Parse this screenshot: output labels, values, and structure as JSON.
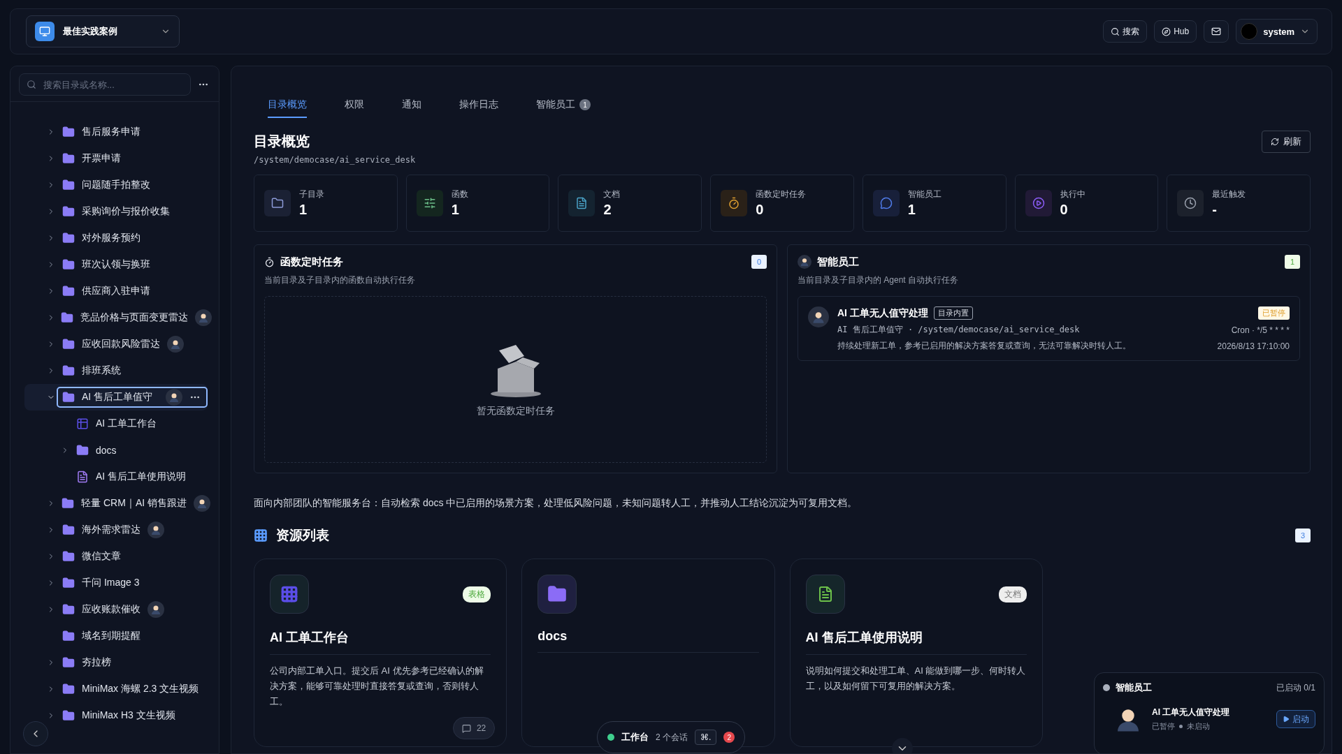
{
  "workspace": {
    "name": "最佳实践案例"
  },
  "topbar": {
    "search": "搜索",
    "hub": "Hub",
    "user": "system"
  },
  "sidebar": {
    "search_placeholder": "搜索目录或名称...",
    "tree": [
      {
        "label": "售后服务申请",
        "kind": "folder",
        "expandable": true,
        "expanded": false,
        "selected": false,
        "agent": false
      },
      {
        "label": "开票申请",
        "kind": "folder",
        "expandable": true,
        "expanded": false,
        "selected": false,
        "agent": false
      },
      {
        "label": "问题随手拍整改",
        "kind": "folder",
        "expandable": true,
        "expanded": false,
        "selected": false,
        "agent": false
      },
      {
        "label": "采购询价与报价收集",
        "kind": "folder",
        "expandable": true,
        "expanded": false,
        "selected": false,
        "agent": false
      },
      {
        "label": "对外服务预约",
        "kind": "folder",
        "expandable": true,
        "expanded": false,
        "selected": false,
        "agent": false
      },
      {
        "label": "班次认领与换班",
        "kind": "folder",
        "expandable": true,
        "expanded": false,
        "selected": false,
        "agent": false
      },
      {
        "label": "供应商入驻申请",
        "kind": "folder",
        "expandable": true,
        "expanded": false,
        "selected": false,
        "agent": false
      },
      {
        "label": "竞品价格与页面变更雷达",
        "kind": "folder",
        "expandable": true,
        "expanded": false,
        "selected": false,
        "agent": true
      },
      {
        "label": "应收回款风险雷达",
        "kind": "folder",
        "expandable": true,
        "expanded": false,
        "selected": false,
        "agent": true
      },
      {
        "label": "排班系统",
        "kind": "folder",
        "expandable": true,
        "expanded": false,
        "selected": false,
        "agent": false
      },
      {
        "label": "AI 售后工单值守",
        "kind": "folder",
        "expandable": true,
        "expanded": true,
        "selected": true,
        "agent": true,
        "children": [
          {
            "label": "AI 工单工作台",
            "kind": "table",
            "expandable": false,
            "selected": false,
            "agent": false
          },
          {
            "label": "docs",
            "kind": "folder",
            "expandable": true,
            "expanded": false,
            "selected": false,
            "agent": false
          },
          {
            "label": "AI 售后工单使用说明",
            "kind": "doc",
            "expandable": false,
            "selected": false,
            "agent": false
          }
        ]
      },
      {
        "label": "轻量 CRM｜AI 销售跟进",
        "kind": "folder",
        "expandable": true,
        "expanded": false,
        "selected": false,
        "agent": true
      },
      {
        "label": "海外需求雷达",
        "kind": "folder",
        "expandable": true,
        "expanded": false,
        "selected": false,
        "agent": true
      },
      {
        "label": "微信文章",
        "kind": "folder",
        "expandable": true,
        "expanded": false,
        "selected": false,
        "agent": false
      },
      {
        "label": "千问 Image 3",
        "kind": "folder",
        "expandable": true,
        "expanded": false,
        "selected": false,
        "agent": false
      },
      {
        "label": "应收账款催收",
        "kind": "folder",
        "expandable": true,
        "expanded": false,
        "selected": false,
        "agent": true
      },
      {
        "label": "域名到期提醒",
        "kind": "folder",
        "expandable": false,
        "selected": false,
        "agent": false
      },
      {
        "label": "夯拉榜",
        "kind": "folder",
        "expandable": true,
        "expanded": false,
        "selected": false,
        "agent": false
      },
      {
        "label": "MiniMax 海螺 2.3 文生视频",
        "kind": "folder",
        "expandable": true,
        "expanded": false,
        "selected": false,
        "agent": false
      },
      {
        "label": "MiniMax H3 文生视频",
        "kind": "folder",
        "expandable": true,
        "expanded": false,
        "selected": false,
        "agent": false
      }
    ]
  },
  "tabs": [
    {
      "label": "目录概览",
      "selected": true
    },
    {
      "label": "权限",
      "selected": false
    },
    {
      "label": "通知",
      "selected": false
    },
    {
      "label": "操作日志",
      "selected": false
    },
    {
      "label": "智能员工",
      "selected": false,
      "badge": "1"
    }
  ],
  "header": {
    "title": "目录概览",
    "path": "/system/democase/ai_service_desk",
    "refresh": "刷新"
  },
  "stats": [
    {
      "kind": "folder",
      "label": "子目录",
      "value": "1"
    },
    {
      "kind": "function",
      "label": "函数",
      "value": "1"
    },
    {
      "kind": "doc",
      "label": "文档",
      "value": "2"
    },
    {
      "kind": "timer",
      "label": "函数定时任务",
      "value": "0"
    },
    {
      "kind": "agent",
      "label": "智能员工",
      "value": "1"
    },
    {
      "kind": "running",
      "label": "执行中",
      "value": "0"
    },
    {
      "kind": "recent",
      "label": "最近触发",
      "value": "-"
    }
  ],
  "scheduled_panel": {
    "title": "函数定时任务",
    "subtitle": "当前目录及子目录内的函数自动执行任务",
    "count": "0",
    "empty": "暂无函数定时任务"
  },
  "agent_panel": {
    "title": "智能员工",
    "subtitle": "当前目录及子目录内的 Agent 自动执行任务",
    "count": "1",
    "agents": [
      {
        "name": "AI 工单无人值守处理",
        "tag": "目录内置",
        "status": "已暂停",
        "path": "AI 售后工单值守 · /system/democase/ai_service_desk",
        "schedule": "Cron · */5 * * * *",
        "description": "持续处理新工单，参考已启用的解决方案答复或查询，无法可靠解决时转人工。",
        "time": "2026/8/13 17:10:00"
      }
    ]
  },
  "description": "面向内部团队的智能服务台：自动检索 docs 中已启用的场景方案，处理低风险问题，未知问题转人工，并推动人工结论沉淀为可复用文档。",
  "resources": {
    "title": "资源列表",
    "count": "3",
    "items": [
      {
        "kind": "table",
        "tag": "表格",
        "name": "AI 工单工作台",
        "description": "公司内部工单入口。提交后 AI 优先参考已经确认的解决方案，能够可靠处理时直接答复或查询，否则转人工。",
        "comments": "22"
      },
      {
        "kind": "folder",
        "name": "docs"
      },
      {
        "kind": "doc",
        "tag": "文档",
        "name": "AI 售后工单使用说明",
        "description": "说明如何提交和处理工单、AI 能做到哪一步、何时转人工，以及如何留下可复用的解决方案。"
      }
    ]
  },
  "dock": {
    "label": "工作台",
    "sessions": "2 个会话",
    "shortcut": "⌘.",
    "badge": "2"
  },
  "agent_widget": {
    "title": "智能员工",
    "summary": "已启动 0/1",
    "agent": "AI 工单无人值守处理",
    "status": "已暂停",
    "run_state": "未启动",
    "button": "启动"
  }
}
